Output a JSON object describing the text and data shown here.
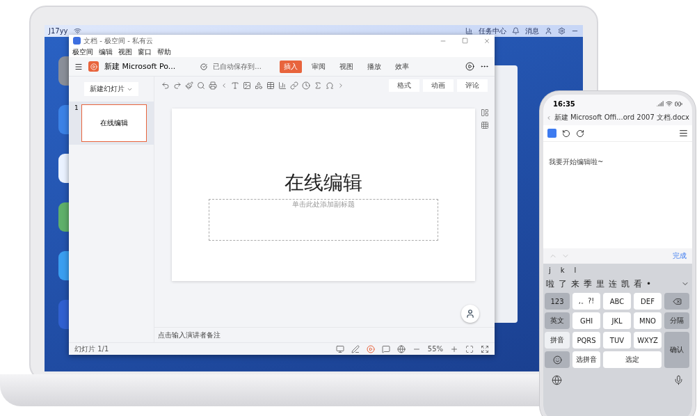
{
  "desktop": {
    "user": "J17yy",
    "topbar_items": [
      {
        "kind": "tasks",
        "label": "任务中心"
      },
      {
        "kind": "messages",
        "label": "消息"
      }
    ]
  },
  "window": {
    "title": "文档 - 极空间 - 私有云",
    "menu": [
      "极空间",
      "编辑",
      "视图",
      "窗口",
      "帮助"
    ],
    "doc_title": "新建 Microsoft Po...",
    "save_status": "已自动保存到...",
    "tabs": [
      {
        "label": "插入",
        "selected": true
      },
      {
        "label": "审阅",
        "selected": false
      },
      {
        "label": "视图",
        "selected": false
      },
      {
        "label": "播放",
        "selected": false
      },
      {
        "label": "效率",
        "selected": false
      }
    ],
    "new_slide": "新建幻灯片",
    "slides": [
      {
        "number": "1",
        "text": "在线编辑",
        "selected": true
      }
    ],
    "panel_tabs": [
      "格式",
      "动画",
      "评论"
    ],
    "slide": {
      "title": "在线编辑",
      "subtitle_placeholder": "单击此处添加副标题"
    },
    "notes_placeholder": "点击输入演讲者备注",
    "status": {
      "slide_count": "幻灯片 1/1",
      "zoom": "55%"
    }
  },
  "phone": {
    "time": "16:35",
    "doc_title": "新建 Microsoft Offi...ord 2007 文档.docx",
    "body": "我要开始编辑啦~",
    "done": "完成",
    "pinyin": [
      "j",
      "k",
      "l"
    ],
    "candidates": [
      "啦",
      "了",
      "来",
      "季",
      "里",
      "连",
      "凯",
      "看",
      "•"
    ],
    "keys": [
      {
        "kind": "side",
        "label": "123",
        "selected": false
      },
      {
        "kind": "letter",
        "label": ",。?!"
      },
      {
        "kind": "letter",
        "label": "ABC"
      },
      {
        "kind": "letter",
        "label": "DEF"
      },
      {
        "kind": "delete"
      },
      {
        "kind": "side",
        "label": "英文",
        "selected": false
      },
      {
        "kind": "letter",
        "label": "GHI"
      },
      {
        "kind": "letter",
        "label": "JKL"
      },
      {
        "kind": "letter",
        "label": "MNO"
      },
      {
        "kind": "side",
        "label": "分隔",
        "selected": false
      },
      {
        "kind": "side",
        "label": "拼音",
        "selected": true
      },
      {
        "kind": "letter",
        "label": "PQRS"
      },
      {
        "kind": "letter",
        "label": "TUV"
      },
      {
        "kind": "letter",
        "label": "WXYZ"
      },
      {
        "kind": "enter",
        "label": "确认"
      },
      {
        "kind": "emoji"
      },
      {
        "kind": "letter",
        "label": "选拼音"
      },
      {
        "kind": "wide",
        "label": "选定"
      }
    ]
  }
}
